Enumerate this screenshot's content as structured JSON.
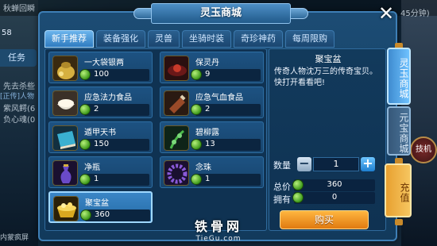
{
  "background": {
    "top_left_text": "秋蝉回瞬",
    "top_right_text": "45分钟)",
    "level": "58",
    "task_tab": "任务",
    "chat_lines": [
      "先去杀些",
      "紫风鳄(6",
      "负心魂(0"
    ],
    "chat_prefix": "[正传]人物",
    "skill_label": "技机",
    "bottom_left_text": "内蒙疯屏"
  },
  "window": {
    "title": "灵玉商城",
    "close_icon": "close-icon"
  },
  "tabs": [
    {
      "label": "新手推荐",
      "active": true
    },
    {
      "label": "装备强化",
      "active": false
    },
    {
      "label": "灵兽",
      "active": false
    },
    {
      "label": "坐骑时装",
      "active": false
    },
    {
      "label": "奇珍神药",
      "active": false
    },
    {
      "label": "每周限购",
      "active": false
    }
  ],
  "items": [
    {
      "name": "一大袋银两",
      "price": "100",
      "icon": "silver-bag-icon",
      "color": "#c9a43a"
    },
    {
      "name": "保灵丹",
      "price": "9",
      "icon": "pill-icon",
      "color": "#7a1e1e"
    },
    {
      "name": "应急法力食品",
      "price": "2",
      "icon": "rice-bowl-icon",
      "color": "#e8e0d0"
    },
    {
      "name": "应急气血食品",
      "price": "2",
      "icon": "meat-icon",
      "color": "#8a4a2a"
    },
    {
      "name": "遁甲天书",
      "price": "150",
      "icon": "book-icon",
      "color": "#3aa6c8"
    },
    {
      "name": "碧柳露",
      "price": "13",
      "icon": "herb-icon",
      "color": "#2a6a2a"
    },
    {
      "name": "净瓶",
      "price": "1",
      "icon": "vase-icon",
      "color": "#5a3aa8"
    },
    {
      "name": "念珠",
      "price": "1",
      "icon": "beads-icon",
      "color": "#7a4ab8"
    },
    {
      "name": "聚宝盆",
      "price": "360",
      "icon": "treasure-bowl-icon",
      "color": "#d8a820",
      "selected": true
    }
  ],
  "detail": {
    "name": "聚宝盆",
    "description": "传奇人物沈万三的传奇宝贝。快打开看看吧!",
    "quantity_label": "数量",
    "quantity": "1",
    "total_label": "总价",
    "total": "360",
    "owned_label": "拥有",
    "owned": "0",
    "buy_label": "购买"
  },
  "side_tabs": [
    {
      "label": "灵玉商城",
      "active": true
    },
    {
      "label": "元宝商城",
      "active": false
    },
    {
      "label": "充值",
      "active": false
    }
  ],
  "watermark": {
    "main": "铁骨网",
    "sub": "TieGu.com"
  },
  "colors": {
    "accent_blue": "#3b86c6",
    "buy_orange": "#e07a10",
    "currency_green": "#3f9a1c"
  }
}
